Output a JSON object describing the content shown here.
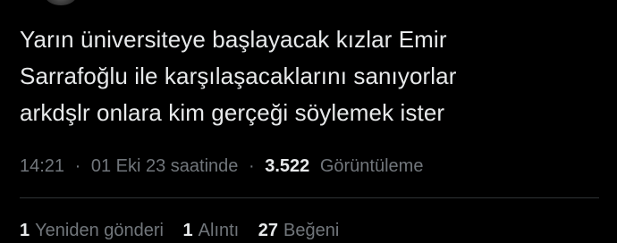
{
  "tweet": {
    "lines": [
      "Yarın üniversiteye başlayacak kızlar Emir",
      "Sarrafoğlu ile karşılaşacaklarını sanıyorlar",
      "arkdşlr onlara kim gerçeği söylemek ister"
    ],
    "time": "14:21",
    "date": "01 Eki 23 saatinde",
    "views_count": "3.522",
    "views_label": "Görüntüleme",
    "separator": "·"
  },
  "stats": {
    "reposts_count": "1",
    "reposts_label": "Yeniden gönderi",
    "quotes_count": "1",
    "quotes_label": "Alıntı",
    "likes_count": "27",
    "likes_label": "Beğeni"
  },
  "colors": {
    "background": "#000000",
    "text": "#e7e9ea",
    "secondary": "#71767b",
    "divider": "#2f3336"
  }
}
